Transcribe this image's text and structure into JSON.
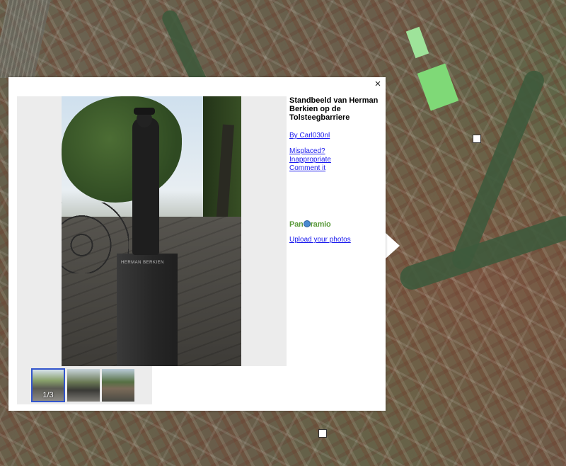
{
  "popup": {
    "close_label": "×",
    "title": "Standbeeld van Herman Berkien op de Tolsteegbarriere",
    "author_link": "By Carl030nl",
    "actions": [
      "Misplaced?",
      "Inappropriate",
      "Comment it"
    ],
    "brand_prefix": "Pan",
    "brand_suffix": "ramio",
    "upload_link": "Upload your photos",
    "pedestal_text": "HERMAN BERKIEN",
    "thumbnails": {
      "counter": "1/3",
      "selected_index": 0
    }
  },
  "colors": {
    "link": "#1a1aee",
    "brand_green": "#5a9a3a",
    "thumb_selected_border": "#3355cc"
  }
}
